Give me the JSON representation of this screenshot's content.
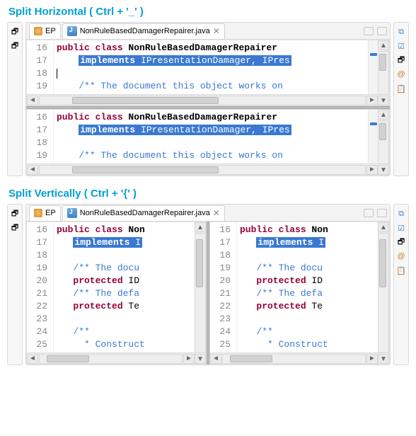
{
  "titles": {
    "horizontal": "Split Horizontal ( Ctrl  + '_' )",
    "vertical": "Split Vertically ( Ctrl + '{' )"
  },
  "tabs": {
    "ep_label": "EP",
    "file_label": "NonRuleBasedDamagerRepairer.java"
  },
  "code_short": {
    "lines": [
      {
        "n": 16,
        "prefix": "public class",
        "rest": " NonRuleBasedDamagerRepairer"
      },
      {
        "n": 17,
        "sel_prefix": "implements",
        "sel_rest": " IPresentationDamager, IPres"
      },
      {
        "n": 18,
        "text": ""
      },
      {
        "n": 19,
        "cmt": "/** The document this object works on "
      }
    ]
  },
  "code_long": {
    "lines": [
      {
        "n": 16,
        "prefix": "public class",
        "rest": " Non"
      },
      {
        "n": 17,
        "sel_prefix": "implements",
        "sel_rest": " I"
      },
      {
        "n": 18,
        "text": ""
      },
      {
        "n": 19,
        "cmt": "/** The docu"
      },
      {
        "n": 20,
        "prefix": "protected",
        "rest": " ID"
      },
      {
        "n": 21,
        "cmt": "/** The defa"
      },
      {
        "n": 22,
        "prefix": "protected",
        "rest": " Te"
      },
      {
        "n": 23,
        "text": ""
      },
      {
        "n": 24,
        "cmt": "/**"
      },
      {
        "n": 25,
        "cmt": " * Construct"
      }
    ]
  }
}
